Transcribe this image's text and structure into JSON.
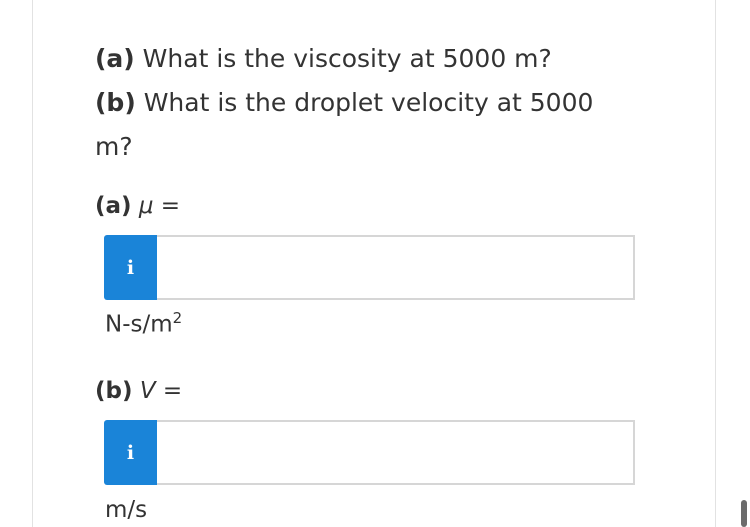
{
  "question": {
    "line1_tag": "(a)",
    "line1_text": " What is the viscosity at 5000 m?",
    "line2_tag": "(b)",
    "line2_text": " What is the droplet velocity at 5000",
    "line3_text": "m?"
  },
  "part_a": {
    "tag": "(a)",
    "symbol": "μ",
    "equals": " =",
    "info_label": "i",
    "value": "",
    "unit_base": "N-s/m",
    "unit_exp": "2"
  },
  "part_b": {
    "tag": "(b)",
    "symbol": "V",
    "equals": " =",
    "info_label": "i",
    "value": "",
    "unit": "m/s"
  }
}
